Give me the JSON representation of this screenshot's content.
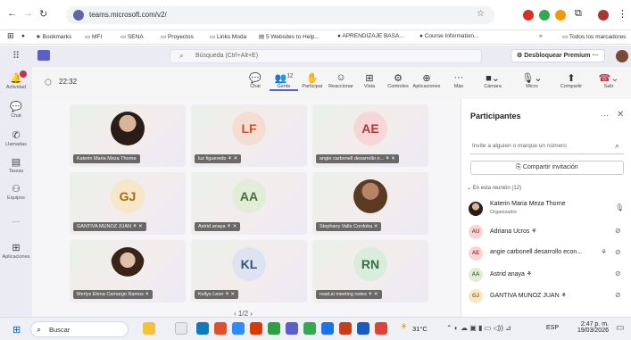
{
  "browser": {
    "url": "teams.microsoft.com/v2/",
    "bookmarks": [
      {
        "label": "Bookmarks"
      },
      {
        "label": "MFI"
      },
      {
        "label": "SENA"
      },
      {
        "label": "Proyectos"
      },
      {
        "label": "Links Moda"
      },
      {
        "label": "5 Websites to Help..."
      },
      {
        "label": "APRENDIZAJE BASA..."
      },
      {
        "label": "Course Information..."
      }
    ],
    "all_bookmarks": "Todos los marcadores",
    "more": "»"
  },
  "teams_header": {
    "search_placeholder": "Búsqueda (Ctrl+Alt+E)",
    "premium_label": "Desbloquear Premium",
    "more": "···"
  },
  "rail": {
    "items": [
      {
        "label": "Actividad",
        "icon": "bell-icon"
      },
      {
        "label": "Chat",
        "icon": "chat-icon"
      },
      {
        "label": "Llamadas",
        "icon": "phone-icon"
      },
      {
        "label": "Tareas",
        "icon": "tasks-icon"
      },
      {
        "label": "Equipos",
        "icon": "teams-icon"
      },
      {
        "label": "···",
        "icon": "more-icon"
      },
      {
        "label": "Aplicaciones",
        "icon": "apps-icon"
      }
    ]
  },
  "meeting": {
    "timer": "22:32",
    "toolbar": [
      {
        "label": "Chat",
        "icon": "chat-icon"
      },
      {
        "label": "Gente",
        "icon": "people-icon",
        "badge": "12"
      },
      {
        "label": "Participar",
        "icon": "raise-hand-icon"
      },
      {
        "label": "Reaccionar",
        "icon": "smile-icon"
      },
      {
        "label": "Vista",
        "icon": "grid-icon"
      },
      {
        "label": "Controles",
        "icon": "controls-icon"
      },
      {
        "label": "Aplicaciones",
        "icon": "apps-plus-icon"
      },
      {
        "label": "Más",
        "icon": "more-icon"
      },
      {
        "label": "Cámara",
        "icon": "camera-off-icon"
      },
      {
        "label": "Micro",
        "icon": "mic-icon"
      },
      {
        "label": "Compartir",
        "icon": "share-icon"
      },
      {
        "label": "Salir",
        "icon": "leave-icon"
      }
    ],
    "tiles": [
      {
        "name": "Katerin Maria Meza Thorne",
        "initials": "",
        "photo": true,
        "color": "#2a1d18"
      },
      {
        "name": "luz figueredo",
        "initials": "LF",
        "photo": false,
        "color": "#c2562e",
        "bg": "#f6ddd3"
      },
      {
        "name": "angie carbonell desarrollo e...",
        "initials": "AE",
        "photo": false,
        "color": "#b03636",
        "bg": "#f6d6d6"
      },
      {
        "name": "GANTIVA MUNOZ JUAN",
        "initials": "GJ",
        "photo": false,
        "color": "#a46a10",
        "bg": "#f7e6c8"
      },
      {
        "name": "Astrid anaya",
        "initials": "AA",
        "photo": false,
        "color": "#4b6a3a",
        "bg": "#e2edd8"
      },
      {
        "name": "Stephany Valle Cordoba",
        "initials": "",
        "photo": true,
        "color": "#5a3a22"
      },
      {
        "name": "Merlys Elena Camargo Ramos",
        "initials": "",
        "photo": true,
        "color": "#3a2418"
      },
      {
        "name": "Kellys Leon",
        "initials": "KL",
        "photo": false,
        "color": "#3b4f7a",
        "bg": "#dde3f1"
      },
      {
        "name": "read.ai meeting notes",
        "initials": "RN",
        "photo": false,
        "color": "#3d6b46",
        "bg": "#d8eddc"
      }
    ],
    "pager": "1/2"
  },
  "participants": {
    "title": "Participantes",
    "invite_placeholder": "Invite a alguien o marque un número",
    "share_invite": "Compartir invitación",
    "section_label": "En esta reunión (12)",
    "people": [
      {
        "name": "Katerin Maria Meza Thorne",
        "role": "Organizador",
        "initials": "",
        "photo": true,
        "color": "#2a1d18",
        "bg": "#2a1d18",
        "mic": "mic-icon"
      },
      {
        "name": "Adriana Ucros",
        "role": "",
        "initials": "AU",
        "photo": false,
        "color": "#b03636",
        "bg": "#f6d6d6",
        "mic": "mic-off-icon"
      },
      {
        "name": "angie carbonell desarrollo econ...",
        "role": "",
        "initials": "AE",
        "photo": false,
        "color": "#b03636",
        "bg": "#f6d6d6",
        "mic": "mic-off-icon"
      },
      {
        "name": "Astrid anaya",
        "role": "",
        "initials": "AA",
        "photo": false,
        "color": "#4b6a3a",
        "bg": "#e2edd8",
        "mic": "mic-off-icon"
      },
      {
        "name": "GANTIVA MUNOZ JUAN",
        "role": "",
        "initials": "GJ",
        "photo": false,
        "color": "#a46a10",
        "bg": "#f7e6c8",
        "mic": "mic-off-icon"
      }
    ]
  },
  "taskbar": {
    "search_label": "Buscar",
    "weather": "31°C",
    "language": "ESP",
    "time": "2:47 p. m.",
    "date": "19/03/2026"
  }
}
